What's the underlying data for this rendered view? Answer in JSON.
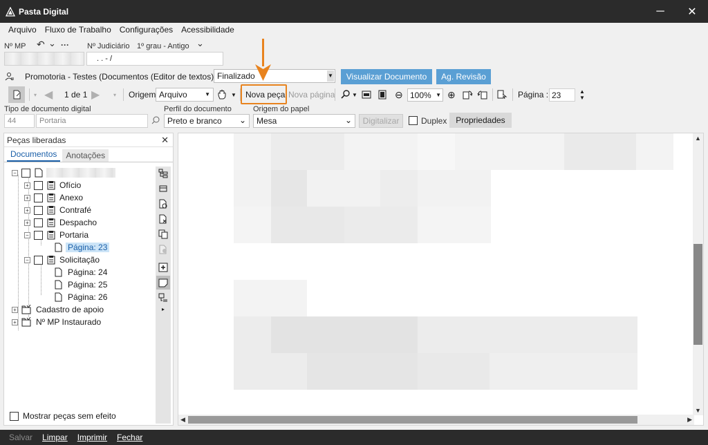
{
  "window": {
    "title": "Pasta Digital",
    "minimize": "─",
    "close": "✕"
  },
  "menu": [
    "Arquivo",
    "Fluxo de Trabalho",
    "Configurações",
    "Acessibilidade"
  ],
  "top_fields": {
    "nmp_label": "Nº MP",
    "undo_glyph": "↶",
    "dropdown_glyph": "⌄",
    "more_glyph": "···",
    "judiciario_label": "Nº Judiciário",
    "grau_label": "1º grau - Antigo",
    "judiciario_value": ". .    - /"
  },
  "promotoria": {
    "text": "Promotoria - Testes (Documentos (Editor de textos)) - Fila",
    "fila_value": "Finalizado",
    "visualizar_btn": "Visualizar Documento",
    "revisao_btn": "Ag. Revisão"
  },
  "toolbar": {
    "page_indicator": "1 de 1",
    "origem_label": "Origem",
    "origem_value": "Arquivo",
    "nova_peca": "Nova peça",
    "nova_pagina": "Nova página",
    "zoom": "100%",
    "pagina_label": "Página :",
    "pagina_value": "23"
  },
  "doc_fields": {
    "tipo_label": "Tipo de documento digital",
    "tipo_code": "44",
    "tipo_value": "Portaria",
    "perfil_label": "Perfil do documento",
    "perfil_value": "Preto e branco",
    "origem_papel_label": "Origem do papel",
    "origem_papel_value": "Mesa",
    "digitalizar_btn": "Digitalizar",
    "duplex_label": "Duplex",
    "propriedades_btn": "Propriedades"
  },
  "left_panel": {
    "title": "Peças liberadas",
    "close_glyph": "✕",
    "tabs": [
      "Documentos",
      "Anotações"
    ],
    "tree": {
      "oficio": "Ofício",
      "anexo": "Anexo",
      "contrafe": "Contrafé",
      "despacho": "Despacho",
      "portaria": "Portaria",
      "pagina23": "Página: 23",
      "solicitacao": "Solicitação",
      "pagina24": "Página: 24",
      "pagina25": "Página: 25",
      "pagina26": "Página: 26",
      "cadastro": "Cadastro de apoio",
      "instaurado": "Nº MP Instaurado"
    },
    "footer_checkbox": "Mostrar peças sem efeito"
  },
  "bottom_bar": [
    "Salvar",
    "Limpar",
    "Imprimir",
    "Fechar"
  ],
  "colors": {
    "accent_blue": "#5a9fd4",
    "callout_orange": "#e8831e",
    "chrome_dark": "#2b2b2b"
  }
}
